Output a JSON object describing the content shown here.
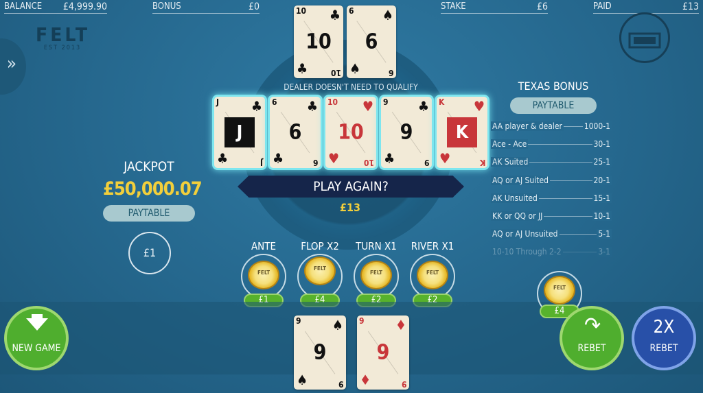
{
  "header": {
    "balance_label": "BALANCE",
    "balance_value": "£4,999.90",
    "bonus_label": "BONUS",
    "bonus_value": "£0",
    "stake_label": "STAKE",
    "stake_value": "£6",
    "paid_label": "PAID",
    "paid_value": "£13"
  },
  "logo": {
    "name": "FELT",
    "sub": "EST 2013"
  },
  "dealer_cards": [
    {
      "rank": "10",
      "suit": "♣",
      "color": "black"
    },
    {
      "rank": "6",
      "suit": "♠",
      "color": "black"
    }
  ],
  "dealer_note": "DEALER DOESN'T NEED TO QUALIFY",
  "community_cards": [
    {
      "rank": "J",
      "suit": "♣",
      "color": "black",
      "face": true
    },
    {
      "rank": "6",
      "suit": "♣",
      "color": "black",
      "face": false
    },
    {
      "rank": "10",
      "suit": "♥",
      "color": "red",
      "face": false
    },
    {
      "rank": "9",
      "suit": "♣",
      "color": "black",
      "face": false
    },
    {
      "rank": "K",
      "suit": "♥",
      "color": "red",
      "face": true
    }
  ],
  "player_cards": [
    {
      "rank": "9",
      "suit": "♠",
      "color": "black"
    },
    {
      "rank": "9",
      "suit": "♦",
      "color": "red"
    }
  ],
  "banner": {
    "text": "PLAY AGAIN?",
    "amount": "£13"
  },
  "jackpot": {
    "title": "JACKPOT",
    "value": "£50,000.07",
    "paytable": "PAYTABLE",
    "bet": "£1"
  },
  "bets": [
    {
      "label": "ANTE",
      "amount": "£1"
    },
    {
      "label": "FLOP X2",
      "amount": "£4"
    },
    {
      "label": "TURN X1",
      "amount": "£2"
    },
    {
      "label": "RIVER X1",
      "amount": "£2"
    }
  ],
  "texas_bonus": {
    "title": "TEXAS BONUS",
    "paytable": "PAYTABLE",
    "bet_amount": "£4",
    "rows": [
      {
        "hand": "AA player & dealer",
        "pay": "1000-1"
      },
      {
        "hand": "Ace - Ace",
        "pay": "30-1"
      },
      {
        "hand": "AK Suited",
        "pay": "25-1"
      },
      {
        "hand": "AQ or AJ Suited",
        "pay": "20-1"
      },
      {
        "hand": "AK Unsuited",
        "pay": "15-1"
      },
      {
        "hand": "KK or QQ or JJ",
        "pay": "10-1"
      },
      {
        "hand": "AQ or AJ Unsuited",
        "pay": "5-1"
      },
      {
        "hand": "10-10 Through 2-2",
        "pay": "3-1"
      }
    ]
  },
  "buttons": {
    "new_game": "NEW GAME",
    "rebet": "REBET",
    "double_big": "2X",
    "double_label": "REBET"
  },
  "chip_text": "FELT"
}
